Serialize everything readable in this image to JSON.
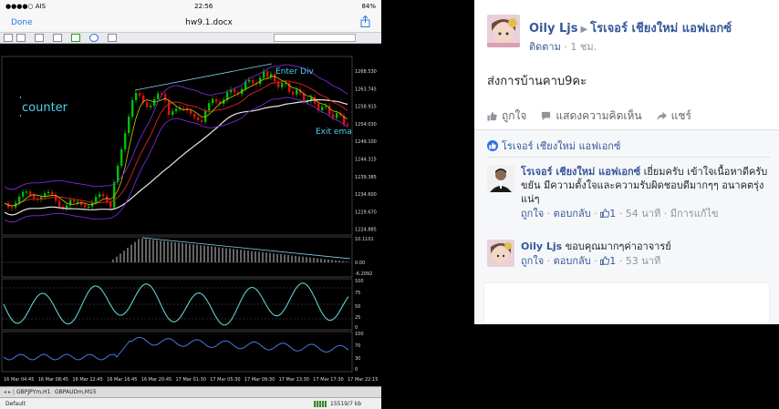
{
  "doc": {
    "status_carrier": "●●●●○ AIS",
    "status_time": "22:56",
    "status_battery": "84%",
    "done_label": "Done",
    "title": "hw9.1.docx"
  },
  "chart": {
    "label_counter": "counter",
    "label_enter": "Enter Div",
    "label_exit": "Exit ema",
    "price_ticks": [
      "1268.530",
      "1263.745",
      "1258.915",
      "1254.030",
      "1249.100",
      "1244.315",
      "1239.385",
      "1234.600",
      "1229.670",
      "1224.885"
    ],
    "macd_ticks": [
      "10.1101",
      "0.00",
      "-6.2092"
    ],
    "stoch_ticks": [
      "100",
      "75",
      "50",
      "25",
      "0"
    ],
    "rsi_ticks": [
      "100",
      "70",
      "30",
      "0"
    ],
    "time_ticks": [
      "16 Mar 04:45",
      "16 Mar 08:45",
      "16 Mar 12:45",
      "16 Mar 16:45",
      "16 Mar 20:45",
      "17 Mar 01:30",
      "17 Mar 05:30",
      "17 Mar 09:30",
      "17 Mar 13:30",
      "17 Mar 17:30",
      "17 Mar 22:15"
    ],
    "tabs": [
      "GBPJPYm,H1",
      "GBPAUDm,M15"
    ],
    "status_left": "Default",
    "status_right": "15519/7 kb",
    "colors": {
      "bull": "#00c000",
      "bear": "#e01010",
      "envelope": "#7a2ad8",
      "ema_white": "#e8e8e8",
      "ema_red": "#d02020",
      "ema_yellow": "#c8c800",
      "trend": "#7fd8e8",
      "osc": "#5fd0d0"
    }
  },
  "fb": {
    "post": {
      "author": "Oily Ljs",
      "group": "โรเจอร์ เชียงใหม่ แอฟเอกซ์",
      "follow": "ติดตาม",
      "time": "1 ชม.",
      "text": "ส่งการบ้านคาบ9คะ"
    },
    "actions": {
      "like": "ถูกใจ",
      "comment": "แสดงความคิดเห็น",
      "share": "แชร์"
    },
    "likes_line": "โรเจอร์ เชียงใหม่ แอฟเอกซ์",
    "comments": [
      {
        "name": "โรเจอร์ เชียงใหม่ แอฟเอกซ์",
        "text": "เยี่ยมครับ เข้าใจเนื้อหาดีครับ ขยัน มีความตั้งใจและความรับผิดชอบดีมากๆๆ อนาคตรุ่งแน่ๆ",
        "like": "ถูกใจ",
        "reply": "ตอบกลับ",
        "count": "1",
        "time": "54 นาที",
        "edited": "มีการแก้ไข"
      },
      {
        "name": "Oily Ljs",
        "text": "ขอบคุณมากๆค่าอาจารย์",
        "like": "ถูกใจ",
        "reply": "ตอบกลับ",
        "count": "1",
        "time": "53 นาที"
      }
    ]
  }
}
